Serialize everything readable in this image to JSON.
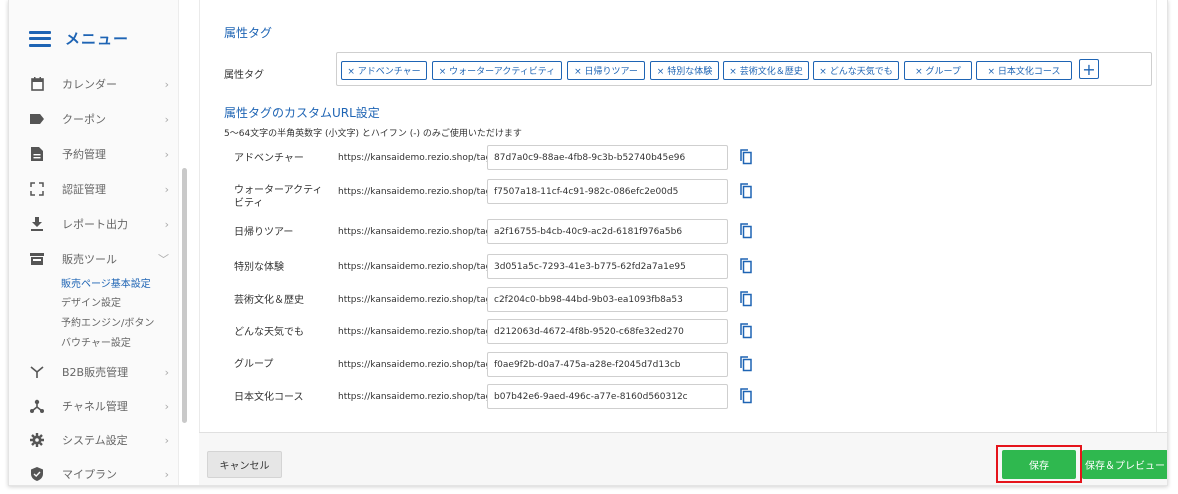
{
  "sidebar": {
    "title": "メニュー",
    "items": [
      {
        "label": "カレンダー",
        "icon": "calendar-icon"
      },
      {
        "label": "クーポン",
        "icon": "tag-icon"
      },
      {
        "label": "予約管理",
        "icon": "document-icon"
      },
      {
        "label": "認証管理",
        "icon": "scan-icon"
      },
      {
        "label": "レポート出力",
        "icon": "download-icon"
      },
      {
        "label": "販売ツール",
        "icon": "store-icon"
      },
      {
        "label": "B2B販売管理",
        "icon": "b2b-icon"
      },
      {
        "label": "チャネル管理",
        "icon": "network-icon"
      },
      {
        "label": "システム設定",
        "icon": "gear-icon"
      },
      {
        "label": "マイプラン",
        "icon": "shield-icon"
      }
    ],
    "sub_items": [
      {
        "label": "販売ページ基本設定",
        "active": true
      },
      {
        "label": "デザイン設定",
        "active": false
      },
      {
        "label": "予約エンジン/ボタン",
        "active": false
      },
      {
        "label": "バウチャー設定",
        "active": false
      }
    ]
  },
  "attributes": {
    "section_title": "属性タグ",
    "row_label": "属性タグ",
    "tags": [
      "× アドベンチャー",
      "× ウォーターアクティビティ",
      "× 日帰りツアー",
      "× 特別な体験",
      "× 芸術文化＆歴史",
      "× どんな天気でも",
      "× グループ",
      "× 日本文化コース"
    ]
  },
  "custom_url": {
    "section_title": "属性タグのカスタムURL設定",
    "note": "5〜64文字の半角英数字 (小文字) とハイフン (-) のみご使用いただけます",
    "prefix": "https://kansaidemo.rezio.shop/tag/",
    "rows": [
      {
        "label": "アドベンチャー",
        "value": "87d7a0c9-88ae-4fb8-9c3b-b52740b45e96"
      },
      {
        "label": "ウォーターアクティビティ",
        "value": "f7507a18-11cf-4c91-982c-086efc2e00d5"
      },
      {
        "label": "日帰りツアー",
        "value": "a2f16755-b4cb-40c9-ac2d-6181f976a5b6"
      },
      {
        "label": "特別な体験",
        "value": "3d051a5c-7293-41e3-b775-62fd2a7a1e95"
      },
      {
        "label": "芸術文化＆歴史",
        "value": "c2f204c0-bb98-44bd-9b03-ea1093fb8a53"
      },
      {
        "label": "どんな天気でも",
        "value": "d212063d-4672-4f8b-9520-c68fe32ed270"
      },
      {
        "label": "グループ",
        "value": "f0ae9f2b-d0a7-475a-a28e-f2045d7d13cb"
      },
      {
        "label": "日本文化コース",
        "value": "b07b42e6-9aed-496c-a77e-8160d560312c"
      }
    ]
  },
  "footer": {
    "cancel_label": "キャンセル",
    "save_label": "保存",
    "save_preview_label": "保存＆プレビュー"
  },
  "colors": {
    "accent": "#1e64b4",
    "save_green": "#2fb84f",
    "highlight_red": "#e5141b"
  }
}
